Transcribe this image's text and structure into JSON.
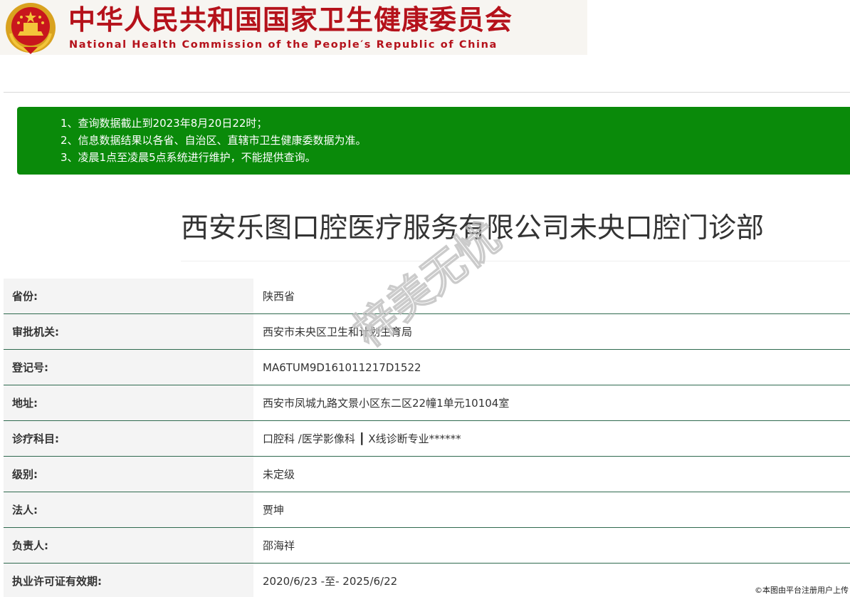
{
  "header": {
    "org_name_cn": "中华人民共和国国家卫生健康委员会",
    "org_name_en": "National Health Commission of the People′s Republic of China",
    "emblem_icon": "national-emblem-icon"
  },
  "notice": {
    "lines": [
      "1、查询数据截止到2023年8月20日22时；",
      "2、信息数据结果以各省、自治区、直辖市卫生健康委数据为准。",
      "3、凌晨1点至凌晨5点系统进行维护，不能提供查询。"
    ],
    "background_color": "#0a8a0a"
  },
  "title": "西安乐图口腔医疗服务有限公司未央口腔门诊部",
  "details": [
    {
      "label": "省份:",
      "value": "陕西省"
    },
    {
      "label": "审批机关:",
      "value": "西安市未央区卫生和计划生育局"
    },
    {
      "label": "登记号:",
      "value": "MA6TUM9D161011217D1522"
    },
    {
      "label": "地址:",
      "value": "西安市凤城九路文景小区东二区22幢1单元10104室"
    },
    {
      "label": "诊疗科目:",
      "value": "口腔科 /医学影像科 ┃ X线诊断专业******"
    },
    {
      "label": "级别:",
      "value": "未定级"
    },
    {
      "label": "法人:",
      "value": "贾坤"
    },
    {
      "label": "负责人:",
      "value": "邵海祥"
    },
    {
      "label": "执业许可证有效期:",
      "value": "2020/6/23 -至- 2025/6/22"
    }
  ],
  "watermark": "梓美无忧",
  "corner_note": "©本图由平台注册用户上传",
  "colors": {
    "brand_red": "#b5121b",
    "row_divider": "#2f6a4f"
  }
}
